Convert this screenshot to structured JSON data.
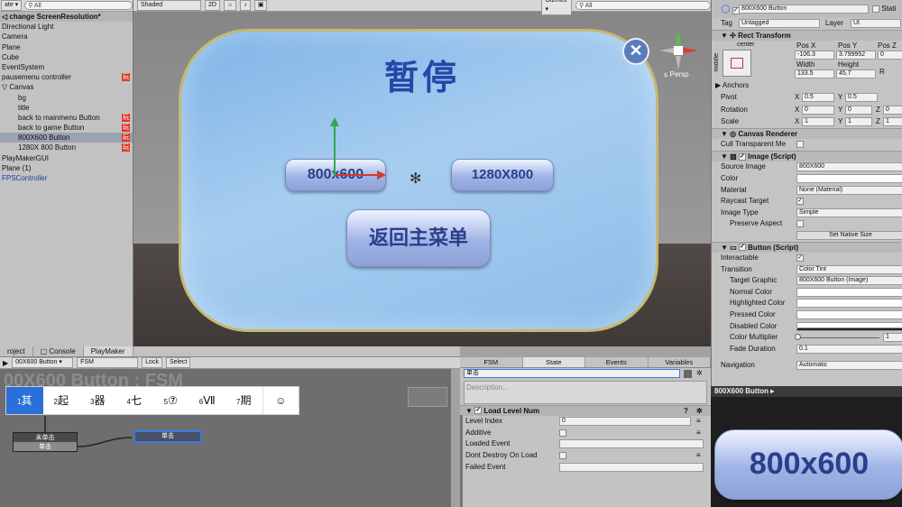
{
  "hierarchy": {
    "create_label": "ate ▾",
    "search_placeholder": "All",
    "scene_title": "change ScreenResolution*",
    "items": [
      {
        "label": "Directional Light",
        "indent": 0
      },
      {
        "label": "Camera",
        "indent": 0
      },
      {
        "label": "Plane",
        "indent": 0
      },
      {
        "label": "Cube",
        "indent": 0
      },
      {
        "label": "EventSystem",
        "indent": 0
      },
      {
        "label": "pausemenu controller",
        "indent": 0,
        "badge": "玩"
      },
      {
        "label": "▽ Canvas",
        "indent": 0
      },
      {
        "label": "bg",
        "indent": 2
      },
      {
        "label": "title",
        "indent": 2
      },
      {
        "label": "back to mainmenu Button",
        "indent": 2,
        "badge": "玩"
      },
      {
        "label": "back to game Button",
        "indent": 2,
        "badge": "玩"
      },
      {
        "label": "800X600 Button",
        "indent": 2,
        "badge": "玩",
        "selected": true
      },
      {
        "label": "1280X 800 Button",
        "indent": 2,
        "badge": "玩"
      },
      {
        "label": "PlayMakerGUI",
        "indent": 0
      },
      {
        "label": "Plane (1)",
        "indent": 0
      },
      {
        "label": "FPSController",
        "indent": 0,
        "blue": true
      }
    ]
  },
  "scene": {
    "shading": "Shaded",
    "mode2d": "2D",
    "gizmos": "Gizmos ▾",
    "search_placeholder": "All",
    "pause_title": "暂停",
    "btn_800": "800x600",
    "btn_1280": "1280X800",
    "btn_main": "返回主菜单",
    "close": "✕",
    "persp": "≤ Persp"
  },
  "inspector": {
    "object_name": "800X600 Button",
    "static_label": "Stati",
    "tag_label": "Tag",
    "tag_value": "Untagged",
    "layer_label": "Layer",
    "layer_value": "UI",
    "rect_transform": "Rect Transform",
    "anchor_center": "center",
    "anchor_middle": "middle",
    "posx_label": "Pos X",
    "posy_label": "Pos Y",
    "posz_label": "Pos Z",
    "posx": "-106.3",
    "posy": "3.799952",
    "posz": "0",
    "width_label": "Width",
    "height_label": "Height",
    "width": "133.5",
    "height": "45.7",
    "anchors": "▶ Anchors",
    "pivot": "Pivot",
    "pivot_x": "0.5",
    "pivot_y": "0.5",
    "rotation": "Rotation",
    "rot_x": "0",
    "rot_y": "0",
    "rot_z": "0",
    "scale": "Scale",
    "scale_x": "1",
    "scale_y": "1",
    "scale_z": "1",
    "canvas_renderer": "Canvas Renderer",
    "cull": "Cull Transparent Me",
    "image_script": "Image (Script)",
    "source_image": "Source Image",
    "source_image_val": "800X600",
    "color": "Color",
    "material": "Material",
    "material_val": "None (Material)",
    "raycast": "Raycast Target",
    "image_type": "Image Type",
    "image_type_val": "Simple",
    "preserve": "Preserve Aspect",
    "native_size": "Set Native Size",
    "button_script": "Button (Script)",
    "interactable": "Interactable",
    "transition": "Transition",
    "transition_val": "Color Tint",
    "target_graphic": "Target Graphic",
    "target_graphic_val": "800X600 Button (Image)",
    "normal_color": "Normal Color",
    "highlighted_color": "Highlighted Color",
    "pressed_color": "Pressed Color",
    "disabled_color": "Disabled Color",
    "color_multiplier": "Color Multiplier",
    "color_multiplier_val": "1",
    "fade": "Fade Duration",
    "fade_val": "0.1",
    "navigation": "Navigation",
    "navigation_val": "Automatic",
    "preview_title": "800X600 Button ▸",
    "preview_text": "800x600"
  },
  "bottom": {
    "tabs": [
      "roject",
      "Console",
      "PlayMaker"
    ],
    "fsm_select": "00X600 Button ▾",
    "fsm_name": "FSM",
    "lock": "Lock",
    "select": "Select",
    "fsm_title": "00X600 Button : FSM",
    "ime": [
      {
        "n": "1",
        "c": "其"
      },
      {
        "n": "2",
        "c": "起"
      },
      {
        "n": "3",
        "c": "器"
      },
      {
        "n": "4",
        "c": "七"
      },
      {
        "n": "5",
        "c": "⑦"
      },
      {
        "n": "6",
        "c": "Ⅶ"
      },
      {
        "n": "7",
        "c": "期"
      }
    ],
    "ime_emoji": "☺",
    "node1_title": "未单击",
    "node1_event": "单击",
    "node2_title": "单击"
  },
  "state_panel": {
    "tabs": [
      "FSM",
      "State",
      "Events",
      "Variables"
    ],
    "state_name": "单击",
    "description_placeholder": "Description...",
    "action_title": "Load Level Num",
    "level_index": "Level Index",
    "level_index_val": "0",
    "additive": "Additive",
    "loaded_event": "Loaded Event",
    "dont_destroy": "Dont Destroy On Load",
    "failed_event": "Failed Event"
  }
}
